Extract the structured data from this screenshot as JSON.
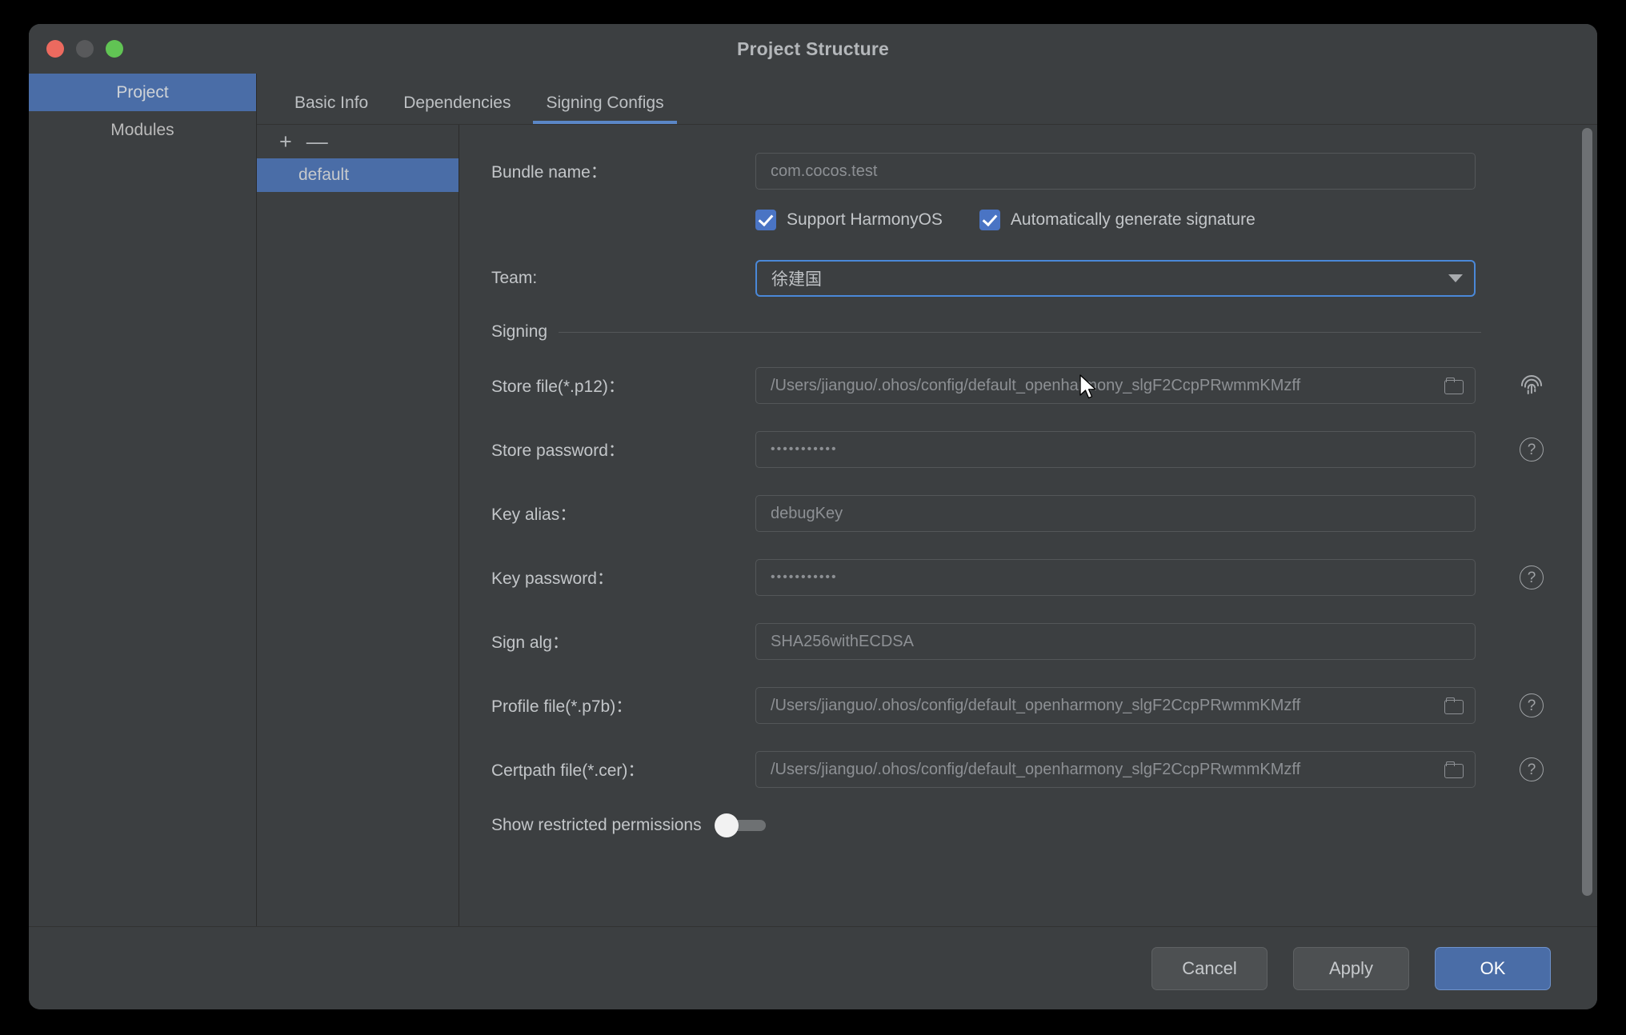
{
  "window": {
    "title": "Project Structure",
    "traffic_lights": [
      "close",
      "minimize",
      "zoom"
    ]
  },
  "sidebar": {
    "items": [
      {
        "label": "Project",
        "selected": true
      },
      {
        "label": "Modules",
        "selected": false
      }
    ]
  },
  "tabs": [
    {
      "label": "Basic Info",
      "active": false
    },
    {
      "label": "Dependencies",
      "active": false
    },
    {
      "label": "Signing Configs",
      "active": true
    }
  ],
  "config_list": {
    "add_label": "+",
    "remove_label": "—",
    "items": [
      {
        "label": "default",
        "selected": true
      }
    ]
  },
  "form": {
    "bundle_name": {
      "label": "Bundle name：",
      "value": "com.cocos.test"
    },
    "checkboxes": [
      {
        "label": "Support HarmonyOS",
        "checked": true
      },
      {
        "label": "Automatically generate signature",
        "checked": true
      }
    ],
    "team": {
      "label": "Team:",
      "value": "徐建国",
      "focused": true
    },
    "signing_group_title": "Signing",
    "fields": [
      {
        "label": "Store file(*.p12)：",
        "value": "/Users/jianguo/.ohos/config/default_openharmony_slgF2CcpPRwmmKMzff",
        "browse": true,
        "side_icon": "fingerprint-icon"
      },
      {
        "label": "Store password：",
        "value": "•••••••••••",
        "browse": false,
        "side_icon": "help-icon"
      },
      {
        "label": "Key alias：",
        "value": "debugKey",
        "browse": false,
        "side_icon": ""
      },
      {
        "label": "Key password：",
        "value": "•••••••••••",
        "browse": false,
        "side_icon": "help-icon"
      },
      {
        "label": "Sign alg：",
        "value": "SHA256withECDSA",
        "browse": false,
        "side_icon": ""
      },
      {
        "label": "Profile file(*.p7b)：",
        "value": "/Users/jianguo/.ohos/config/default_openharmony_slgF2CcpPRwmmKMzff",
        "browse": true,
        "side_icon": "help-icon"
      },
      {
        "label": "Certpath file(*.cer)：",
        "value": "/Users/jianguo/.ohos/config/default_openharmony_slgF2CcpPRwmmKMzff",
        "browse": true,
        "side_icon": "help-icon"
      }
    ],
    "restricted": {
      "label": "Show restricted permissions",
      "enabled": false
    }
  },
  "footer": {
    "cancel": "Cancel",
    "apply": "Apply",
    "ok": "OK"
  },
  "colors": {
    "accent": "#4a6da7",
    "focus_border": "#4a88d8",
    "window_bg": "#3c3f41",
    "checkbox": "#4a74c4"
  }
}
